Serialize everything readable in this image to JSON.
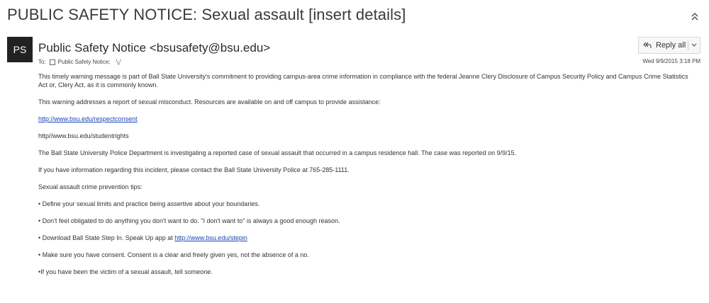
{
  "subject": "PUBLIC SAFETY NOTICE: Sexual assault [insert details]",
  "avatar_initials": "PS",
  "sender": "Public Safety Notice <bsusafety@bsu.edu>",
  "to": {
    "label": "To:",
    "recipient": "Public Safety Notice;"
  },
  "reply_all_label": "Reply all",
  "date": "Wed 9/9/2015 3:18 PM",
  "body": {
    "p1": "This timely warning message is part of Ball State University's commitment to providing campus-area crime information in compliance with the federal Jeanne Clery Disclosure of Campus Security Policy and Campus Crime Statistics Act or, Clery Act, as it is commonly known.",
    "p2": "This warning addresses a report of sexual misconduct. Resources are available on and off campus to provide assistance:",
    "link1": "http://www.bsu.edu/respectconsent",
    "p3": "http//www.bsu.edu/studentrights",
    "p4": "The Ball State University Police Department is investigating a reported case of sexual assault that occurred in a campus residence hall.  The case was reported on 9/9/15.",
    "p5": "If you have information regarding this incident, please contact the Ball State University Police at 765-285-1111.",
    "p6": "Sexual assault crime prevention tips:",
    "tip1": "• Define your sexual limits and practice being assertive about your boundaries.",
    "tip2": "• Don't feel obligated to do anything you don't want to do. \"I don't want to\" is always a good enough reason.",
    "tip3_prefix": "• Download Ball State Step In. Speak Up app at ",
    "tip3_link": "http://www.bsu.edu/stepin",
    "tip4": "• Make sure you have consent. Consent is a clear and freely given yes, not the absence of a no.",
    "tip5": "•If you have been the victim of a sexual assault, tell someone."
  }
}
